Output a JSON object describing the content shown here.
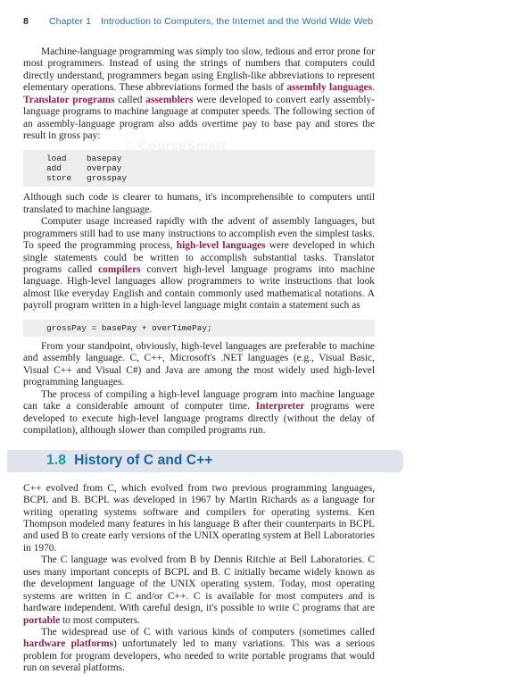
{
  "page": {
    "folio": "8",
    "running_head": {
      "chapter": "Chapter 1",
      "title": "Introduction to Computers, the Internet and the World Wide Web"
    },
    "watermark": "© CourseSmart"
  },
  "colors": {
    "running_head": "#2d6ca8",
    "defined_term": "#8e1f4f",
    "section_number": "#0e9aa0",
    "section_title": "#18639f",
    "section_bar_bg": "#dfe3ee",
    "code_bg": "#eceded",
    "body_text": "#231f20"
  },
  "content": {
    "p1": {
      "seg1": "Machine-language programming was simply too slow, tedious and error prone for most programmers. Instead of using the strings of numbers that computers could directly understand, programmers began using English-like abbreviations to represent elementary operations. These abbreviations formed the basis of ",
      "term1": "assembly languages",
      "seg2": ". ",
      "term2": "Translator programs",
      "seg3": " called ",
      "term3": "assemblers",
      "seg4": " were developed to convert early assembly-language programs to machine language at computer speeds. The following section of an assembly-language program also adds overtime pay to base pay and stores the result in gross pay:"
    },
    "code1": [
      {
        "op": "load",
        "operand": "basepay"
      },
      {
        "op": "add",
        "operand": "overpay"
      },
      {
        "op": "store",
        "operand": "grosspay"
      }
    ],
    "p2": "Although such code is clearer to humans, it's incomprehensible to computers until translated to machine language.",
    "p3": {
      "seg1": "Computer usage increased rapidly with the advent of assembly languages, but programmers still had to use many instructions to accomplish even the simplest tasks. To speed the programming process, ",
      "term1": "high-level languages",
      "seg2": " were developed in which single statements could be written to accomplish substantial tasks. Translator programs called ",
      "term2": "compilers",
      "seg3": " convert high-level language programs into machine language. High-level languages allow programmers to write instructions that look almost like everyday English and contain commonly used mathematical notations. A payroll program written in a high-level language might contain a statement such as"
    },
    "code2": "grossPay = basePay + overTimePay;",
    "p4": "From your standpoint, obviously, high-level languages are preferable to machine and assembly language. C, C++, Microsoft's .NET languages (e.g., Visual Basic, Visual C++ and Visual C#) and Java are among the most widely used high-level programming languages.",
    "p5": {
      "seg1": "The process of compiling a high-level language program into machine language can take a considerable amount of computer time. ",
      "term1": "Interpreter",
      "seg2": " programs were developed to execute high-level language programs directly (without the delay of compilation), although slower than compiled programs run."
    },
    "section": {
      "number": "1.8",
      "title": "History of C and C++"
    },
    "p6": "C++ evolved from C, which evolved from two previous programming languages, BCPL and B. BCPL was developed in 1967 by Martin Richards as a language for writing operating systems software and compilers for operating systems. Ken Thompson modeled many features in his language B after their counterparts in BCPL and used B to create early versions of the UNIX operating system at Bell Laboratories in 1970.",
    "p7": {
      "seg1": "The C language was evolved from B by Dennis Ritchie at Bell Laboratories. C uses many important concepts of BCPL and B. C initially became widely known as the development language of the UNIX operating system. Today, most operating systems are written in C and/or C++. C is available for most computers and is hardware independent. With careful design, it's possible to write C programs that are ",
      "term1": "portable",
      "seg2": " to most computers."
    },
    "p8": {
      "seg1": "The widespread use of C with various kinds of computers (sometimes called ",
      "term1": "hardware platforms",
      "seg2": ") unfortunately led to many variations. This was a serious problem for program developers, who needed to write portable programs that would run on several platforms."
    }
  }
}
